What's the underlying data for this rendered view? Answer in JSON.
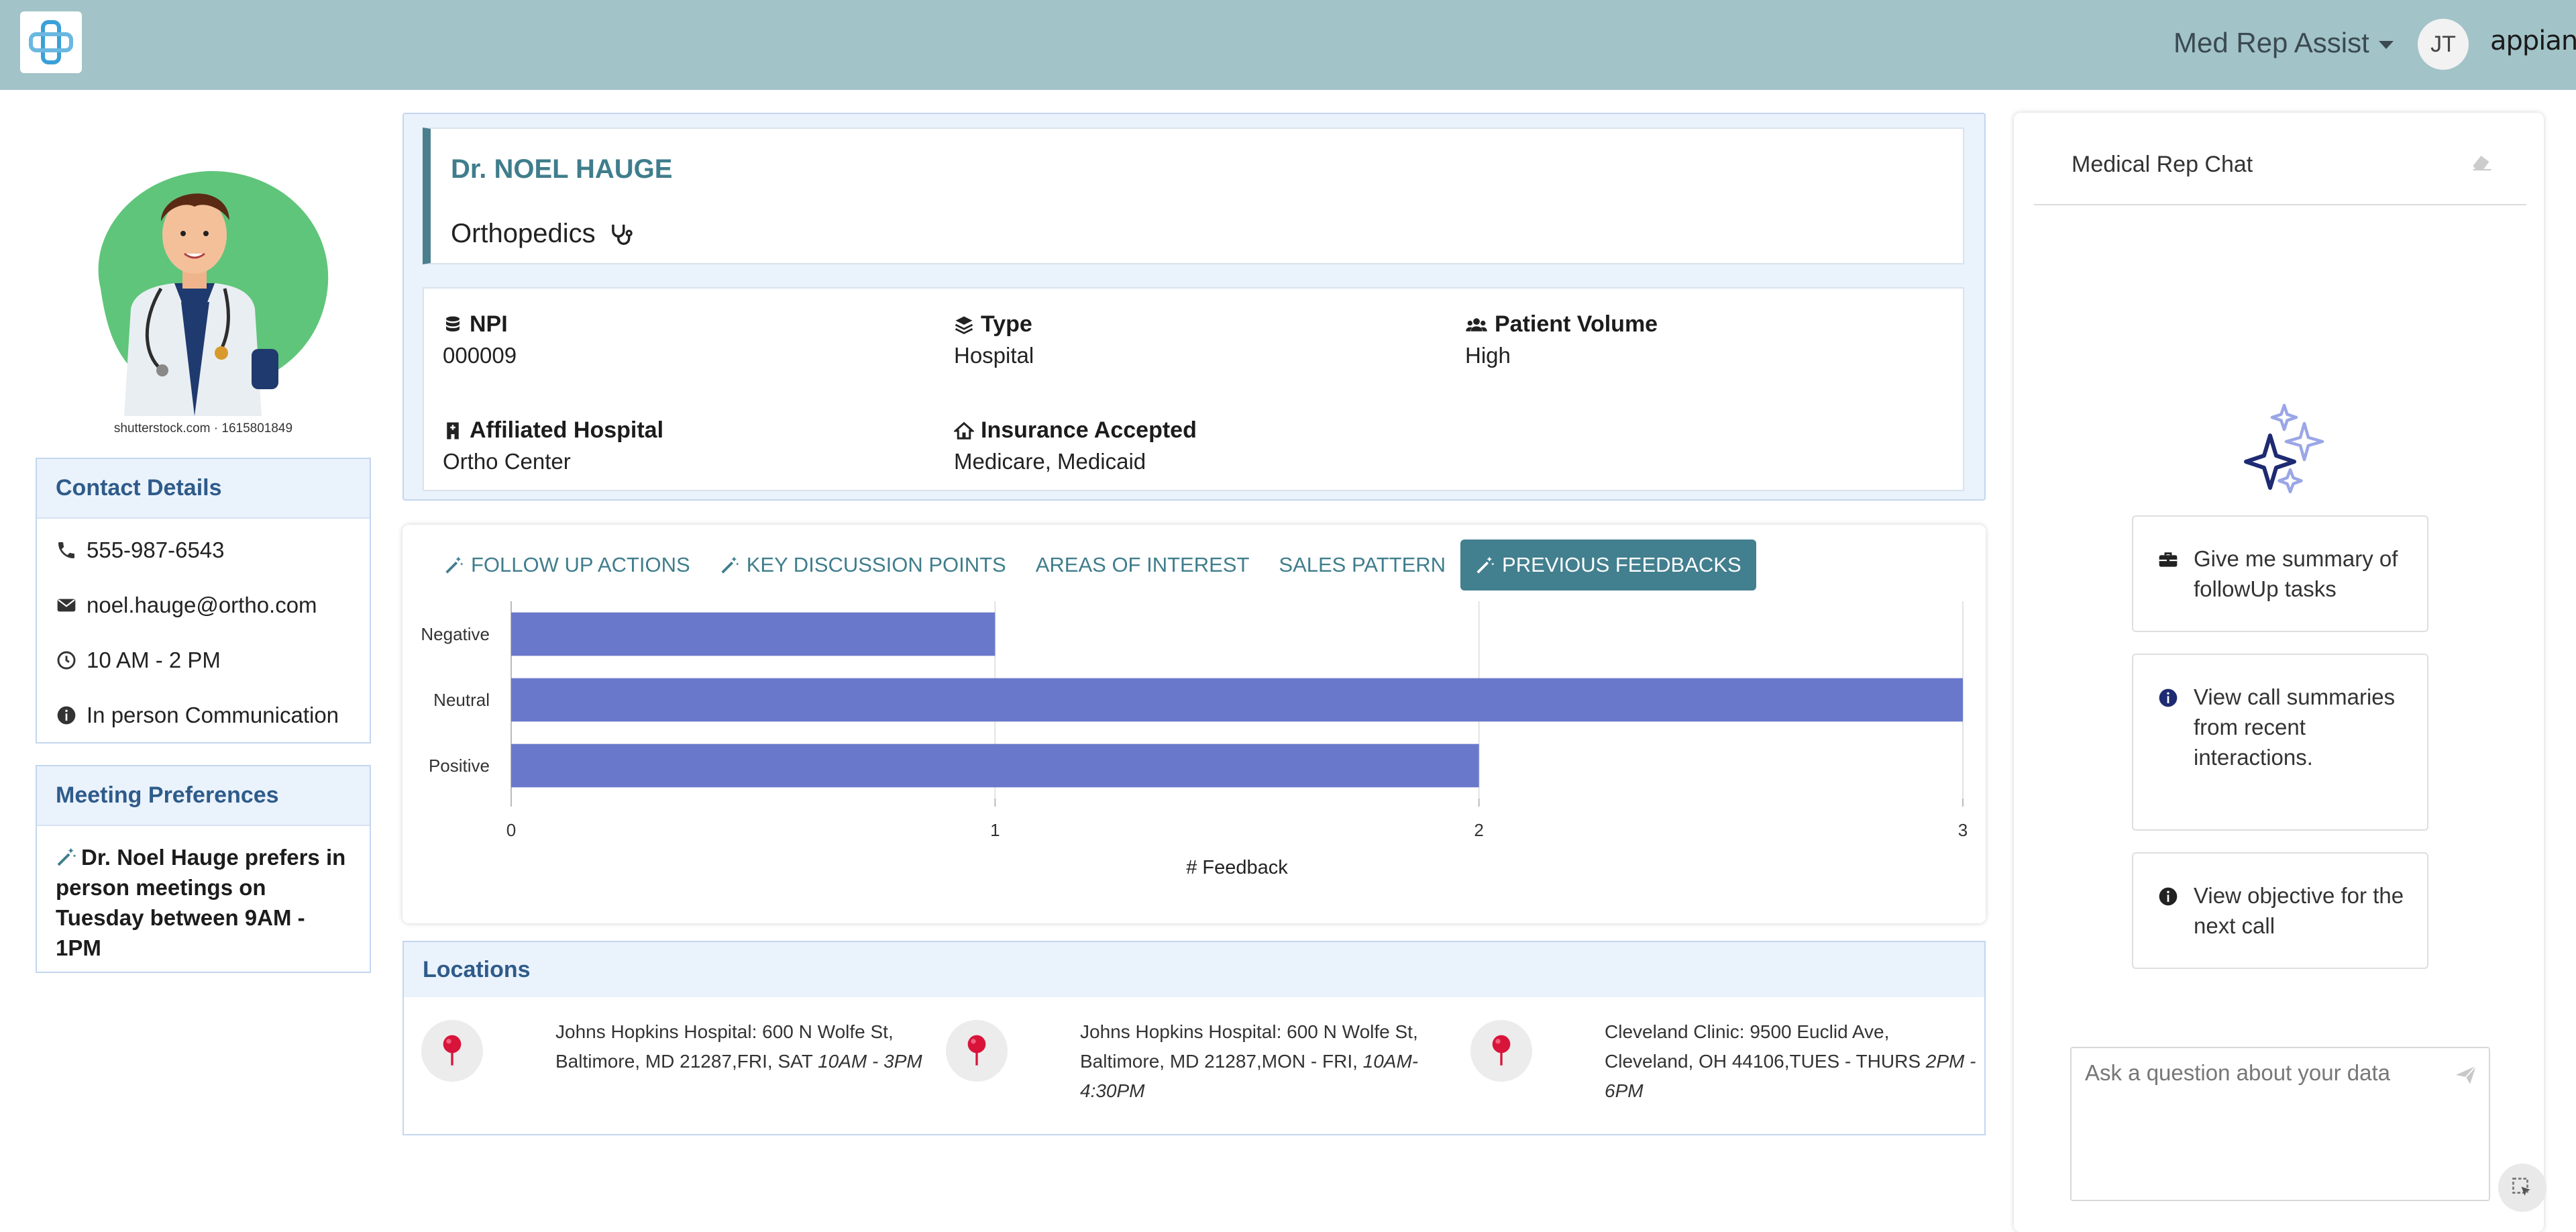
{
  "header": {
    "app_name": "Med Rep Assist",
    "user_initials": "JT",
    "brand": "appian"
  },
  "profile": {
    "image_credit": "shutterstock.com · 1615801849",
    "contact": {
      "title": "Contact Details",
      "phone": "555-987-6543",
      "email": "noel.hauge@ortho.com",
      "hours": "10 AM - 2 PM",
      "communication": "In person Communication"
    },
    "meeting": {
      "title": "Meeting Preferences",
      "text": "Dr. Noel Hauge prefers in person meetings on Tuesday between 9AM - 1PM"
    }
  },
  "doctor": {
    "name": "Dr. NOEL HAUGE",
    "specialty": "Orthopedics",
    "fields": {
      "npi": {
        "label": "NPI",
        "value": "000009"
      },
      "type": {
        "label": "Type",
        "value": "Hospital"
      },
      "patient_volume": {
        "label": "Patient Volume",
        "value": "High"
      },
      "hospital": {
        "label": "Affiliated Hospital",
        "value": "Ortho Center"
      },
      "insurance": {
        "label": "Insurance Accepted",
        "value": "Medicare, Medicaid"
      }
    }
  },
  "tabs": [
    {
      "label": "FOLLOW UP ACTIONS",
      "ai": true,
      "active": false
    },
    {
      "label": "KEY DISCUSSION POINTS",
      "ai": true,
      "active": false
    },
    {
      "label": "AREAS OF INTEREST",
      "ai": false,
      "active": false
    },
    {
      "label": "SALES PATTERN",
      "ai": false,
      "active": false
    },
    {
      "label": "PREVIOUS FEEDBACKS",
      "ai": true,
      "active": true
    }
  ],
  "chart_data": {
    "type": "bar",
    "orientation": "horizontal",
    "categories": [
      "Negative",
      "Neutral",
      "Positive"
    ],
    "values": [
      1,
      3,
      2
    ],
    "xlabel": "# Feedback",
    "xlim": [
      0,
      3
    ],
    "xticks": [
      "0",
      "1",
      "2",
      "3"
    ],
    "grid": true,
    "color": "#6a78cb"
  },
  "locations": {
    "title": "Locations",
    "items": [
      {
        "address": "Johns Hopkins Hospital: 600 N Wolfe St, Baltimore, MD 21287,FRI, SAT ",
        "time": "10AM - 3PM"
      },
      {
        "address": "Johns Hopkins Hospital: 600 N Wolfe St, Baltimore, MD 21287,MON - FRI, ",
        "time": "10AM-4:30PM"
      },
      {
        "address": "Cleveland Clinic: 9500 Euclid Ave, Cleveland, OH 44106,TUES - THURS ",
        "time": "2PM - 6PM"
      }
    ]
  },
  "chat": {
    "title": "Medical Rep Chat",
    "suggestions": [
      {
        "text": "Give me summary of followUp tasks",
        "icon": "briefcase-icon"
      },
      {
        "text": "View call summaries from recent interactions.",
        "icon": "info-icon"
      },
      {
        "text": "View objective for the next call",
        "icon": "info-icon"
      }
    ],
    "placeholder": "Ask a question about your data"
  },
  "colors": {
    "topbar": "#a2c3c8",
    "accent": "#427f8f",
    "bar": "#6a78cb",
    "pin": "#d8143a"
  }
}
